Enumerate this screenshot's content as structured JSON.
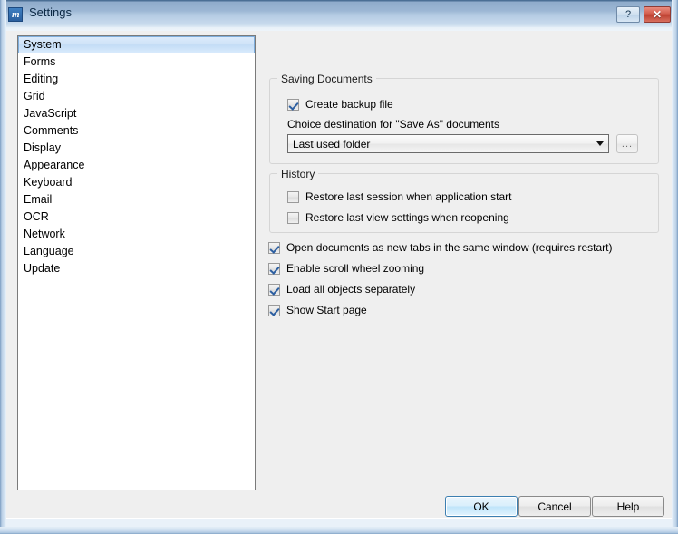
{
  "window": {
    "title": "Settings",
    "app_icon": "app-logo-icon",
    "help_button_label": "?",
    "close_button_label": "✕"
  },
  "sidebar": {
    "selected": "System",
    "items": [
      {
        "label": "System"
      },
      {
        "label": "Forms"
      },
      {
        "label": "Editing"
      },
      {
        "label": "Grid"
      },
      {
        "label": "JavaScript"
      },
      {
        "label": "Comments"
      },
      {
        "label": "Display"
      },
      {
        "label": "Appearance"
      },
      {
        "label": "Keyboard"
      },
      {
        "label": "Email"
      },
      {
        "label": "OCR"
      },
      {
        "label": "Network"
      },
      {
        "label": "Language"
      },
      {
        "label": "Update"
      }
    ]
  },
  "saving_documents": {
    "group_title": "Saving Documents",
    "create_backup": {
      "label": "Create backup file",
      "checked": true
    },
    "destination_label": "Choice destination for \"Save As\" documents",
    "destination_combo": {
      "value": "Last used folder",
      "options": [
        "Last used folder"
      ]
    },
    "browse_button_label": "..."
  },
  "history": {
    "group_title": "History",
    "restore_session": {
      "label": "Restore last session when application start",
      "checked": false
    },
    "restore_view": {
      "label": "Restore last view settings when reopening",
      "checked": false
    }
  },
  "options": [
    {
      "label": "Open documents as new tabs in the same window (requires restart)",
      "checked": true
    },
    {
      "label": "Enable scroll wheel zooming",
      "checked": true
    },
    {
      "label": "Load all objects separately",
      "checked": true
    },
    {
      "label": "Show Start page",
      "checked": true
    }
  ],
  "buttons": {
    "ok": "OK",
    "cancel": "Cancel",
    "help": "Help"
  },
  "colors": {
    "dialog_background": "#efefef",
    "titlebar_top": "#8fabcb",
    "titlebar_bottom": "#dfeaf6",
    "selection_blue": "#c3dcf6",
    "close_red": "#bb3f2f",
    "checkmark_blue": "#2d5fa1",
    "default_button_border": "#3c7fb1"
  }
}
